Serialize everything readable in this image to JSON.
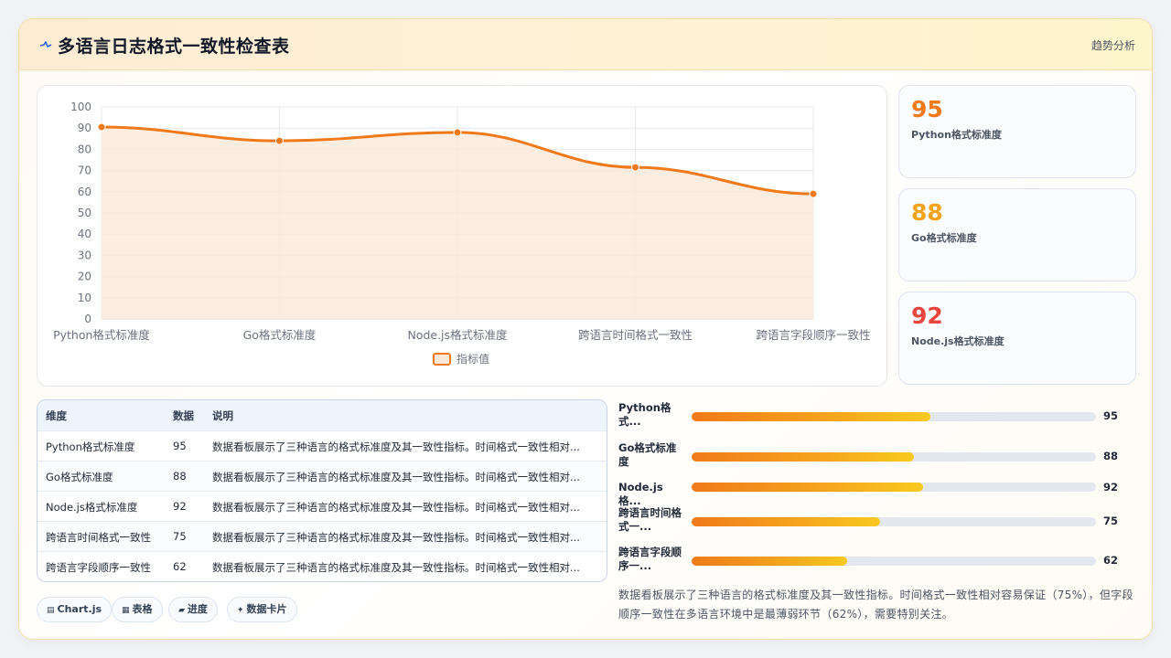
{
  "header": {
    "title": "多语言日志格式一致性检查表",
    "action_label": "趋势分析",
    "logo_icon": "pulse-icon",
    "accent": "#f07a1a"
  },
  "chart_data": {
    "type": "line",
    "categories": [
      "Python格式标准度",
      "Go格式标准度",
      "Node.js格式标准度",
      "跨语言时间格式一致性",
      "跨语言字段顺序一致性"
    ],
    "series": [
      {
        "name": "指标值",
        "values": [
          90.5,
          84,
          88,
          71.5,
          59
        ],
        "color": "#f07a1a",
        "fill": "#fde8da"
      }
    ],
    "yticks": [
      0,
      10,
      20,
      30,
      40,
      50,
      60,
      70,
      80,
      90,
      100
    ],
    "ylim": [
      0,
      100
    ],
    "grid": true,
    "legend": "bottom"
  },
  "cards": [
    {
      "value": "95",
      "label": "Python格式标准度",
      "color": "#f07a1a"
    },
    {
      "value": "88",
      "label": "Go格式标准度",
      "color": "#f2a21b"
    },
    {
      "value": "92",
      "label": "Node.js格式标准度",
      "color": "#e8453c"
    }
  ],
  "table": {
    "headers": [
      "维度",
      "数据",
      "说明"
    ],
    "rows": [
      [
        "Python格式标准度",
        "95",
        "数据看板展示了三种语言的格式标准度及其一致性指标。时间格式一致性相对..."
      ],
      [
        "Go格式标准度",
        "88",
        "数据看板展示了三种语言的格式标准度及其一致性指标。时间格式一致性相对..."
      ],
      [
        "Node.js格式标准度",
        "92",
        "数据看板展示了三种语言的格式标准度及其一致性指标。时间格式一致性相对..."
      ],
      [
        "跨语言时间格式一致性",
        "75",
        "数据看板展示了三种语言的格式标准度及其一致性指标。时间格式一致性相对..."
      ],
      [
        "跨语言字段顺序一致性",
        "62",
        "数据看板展示了三种语言的格式标准度及其一致性指标。时间格式一致性相对..."
      ]
    ]
  },
  "chips": [
    {
      "icon": "chart-icon",
      "glyph": "▤",
      "label": "Chart.js"
    },
    {
      "icon": "table-icon",
      "glyph": "▦",
      "label": "表格"
    },
    {
      "icon": "progress-icon",
      "glyph": "▰",
      "label": "进度"
    },
    {
      "icon": "card-icon",
      "glyph": "✦",
      "label": "数据卡片"
    }
  ],
  "progress": [
    {
      "label": "Python格\n式...",
      "value": "95",
      "fraction": 0.59
    },
    {
      "label": "Go格式标准\n度",
      "value": "88",
      "fraction": 0.549
    },
    {
      "label": "Node.js格...",
      "value": "92",
      "fraction": 0.572
    },
    {
      "label": "跨语言时间格\n式一...",
      "value": "75",
      "fraction": 0.466
    },
    {
      "label": "跨语言字段顺\n序一...",
      "value": "62",
      "fraction": 0.385
    }
  ],
  "summary": "数据看板展示了三种语言的格式标准度及其一致性指标。时间格式一致性相对容易保证（75%），但字段顺序一致性在多语言环境中是最薄弱环节（62%），需要特别关注。"
}
